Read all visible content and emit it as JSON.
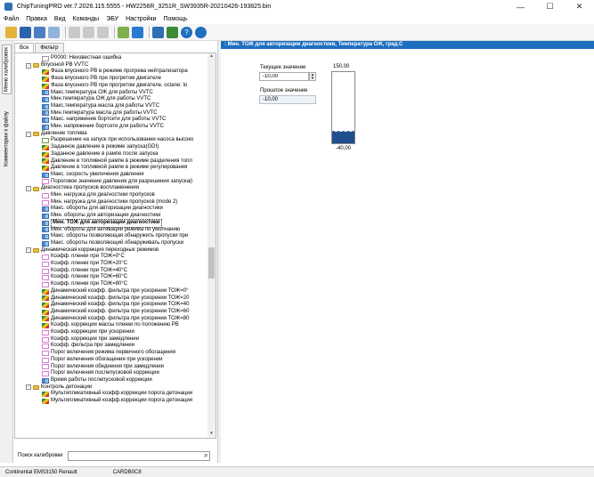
{
  "window": {
    "title": "ChipTuningPRO ver.7.2026.115.5555 - HW2256R_3251R_SW3935R-20210426-193825.bin",
    "minimize": "—",
    "maximize": "☐",
    "close": "✕"
  },
  "menu": [
    "Файл",
    "Правка",
    "Вид",
    "Команды",
    "ЭБУ",
    "Настройки",
    "Помощь"
  ],
  "side_tabs": {
    "maps": "Меню калибровок",
    "comments": "Комментарии к файлу"
  },
  "tree_tabs": [
    "Все",
    "Фильтр"
  ],
  "tree": [
    {
      "level": 2,
      "icon": "error-icon",
      "label": "P0000: Неизвестная ошибка"
    },
    {
      "level": 1,
      "icon": "folder-icon",
      "expand": "-",
      "label": "Впускной РВ VVTC"
    },
    {
      "level": 2,
      "icon": "map-3d-icon",
      "label": "Фаза впускного РВ в режиме прогрева нейтрализатора"
    },
    {
      "level": 2,
      "icon": "map-3d-icon",
      "label": "Фаза впускного РВ при прогретом двигателе"
    },
    {
      "level": 2,
      "icon": "map-3d-icon",
      "label": "Фаза впускного РВ при прогретом двигателе.  octane: lo"
    },
    {
      "level": 2,
      "icon": "map-2d-icon",
      "label": "Макс.температура ОЖ для работы VVTC"
    },
    {
      "level": 2,
      "icon": "map-2d-icon",
      "label": "Мин.температура ОЖ для работы VVTC"
    },
    {
      "level": 2,
      "icon": "map-2d-icon",
      "label": "Макс.температура масла для работы VVTC"
    },
    {
      "level": 2,
      "icon": "map-2d-icon",
      "label": "Мин.температура масла для работы VVTC"
    },
    {
      "level": 2,
      "icon": "map-2d-icon",
      "label": "Макс. напряжение бортсети для работы VVTC"
    },
    {
      "level": 2,
      "icon": "map-2d-icon",
      "label": "Мин. напряжение бортсети для работы VVTC"
    },
    {
      "level": 1,
      "icon": "folder-icon",
      "expand": "-",
      "label": "Давление топлива"
    },
    {
      "level": 2,
      "icon": "check-icon",
      "label": "Разрешение на запуск при использовании насоса высоко"
    },
    {
      "level": 2,
      "icon": "map-3d-icon",
      "label": "Заданное давление в режиме запуска(GDI)"
    },
    {
      "level": 2,
      "icon": "map-3d-icon",
      "label": "Заданное давление в рампе после запуска"
    },
    {
      "level": 2,
      "icon": "map-3d-icon",
      "label": "Давление в топливной рампе в режиме разделения топл"
    },
    {
      "level": 2,
      "icon": "map-3d-icon",
      "label": "Давление в топливной рампе в режиме регулирования"
    },
    {
      "level": 2,
      "icon": "map-2d-icon",
      "label": "Макс. скорость увеличения давления"
    },
    {
      "level": 2,
      "icon": "curve-icon",
      "label": "Пороговое значение давления для разрешения запуска(i"
    },
    {
      "level": 1,
      "icon": "folder-icon",
      "expand": "-",
      "label": "Диагностика пропусков воспламенения"
    },
    {
      "level": 2,
      "icon": "curve-icon",
      "label": "Мин. нагрузка для диагностики пропусков"
    },
    {
      "level": 2,
      "icon": "curve-icon",
      "label": "Мин. нагрузка для диагностики пропусков (mode 2)"
    },
    {
      "level": 2,
      "icon": "map-2d-icon",
      "label": "Макс. обороты для авторизации диагностики"
    },
    {
      "level": 2,
      "icon": "map-2d-icon",
      "label": "Мин. обороты для авторизации диагностики"
    },
    {
      "level": 2,
      "icon": "map-2d-icon",
      "label": "Мин. ТОЖ для авторизации диагностики",
      "selected": true
    },
    {
      "level": 2,
      "icon": "map-2d-icon",
      "label": "Мин. обороты для активации режима по умолчанию"
    },
    {
      "level": 2,
      "icon": "map-2d-icon",
      "label": "Макс. обороты  позволяющая обнаружить пропуски при"
    },
    {
      "level": 2,
      "icon": "map-2d-icon",
      "label": "Макс. обороты позволяющий обнаруживать пропуски"
    },
    {
      "level": 1,
      "icon": "folder-icon",
      "expand": "-",
      "label": "Динамическая коррекция переходных режимов"
    },
    {
      "level": 2,
      "icon": "curve-icon",
      "label": "Коэфф. пленки при ТОЖ=0°C"
    },
    {
      "level": 2,
      "icon": "curve-icon",
      "label": "Коэфф. пленки при ТОЖ=20°C"
    },
    {
      "level": 2,
      "icon": "curve-icon",
      "label": "Коэфф. пленки при ТОЖ=40°C"
    },
    {
      "level": 2,
      "icon": "curve-icon",
      "label": "Коэфф. пленки при ТОЖ=60°C"
    },
    {
      "level": 2,
      "icon": "curve-icon",
      "label": "Коэфф. пленки при ТОЖ=80°C"
    },
    {
      "level": 2,
      "icon": "map-3d-icon",
      "label": "Динамический коэфф. фильтра при ускорении ТОЖ=0°"
    },
    {
      "level": 2,
      "icon": "map-3d-icon",
      "label": "Динамический коэфф. фильтра при ускорении ТОЖ=20"
    },
    {
      "level": 2,
      "icon": "map-3d-icon",
      "label": "Динамический коэфф. фильтра при ускорении ТОЖ=40"
    },
    {
      "level": 2,
      "icon": "map-3d-icon",
      "label": "Динамический коэфф. фильтра при ускорении ТОЖ=60"
    },
    {
      "level": 2,
      "icon": "map-3d-icon",
      "label": "Динамический коэфф. фильтра при ускорении ТОЖ=80"
    },
    {
      "level": 2,
      "icon": "map-3d-icon",
      "label": "Коэфф. коррекции массы пленки по положению РВ"
    },
    {
      "level": 2,
      "icon": "curve-icon",
      "label": "Коэфф. коррекции при ускорении"
    },
    {
      "level": 2,
      "icon": "curve-icon",
      "label": "Коэфф. коррекции при замедлении"
    },
    {
      "level": 2,
      "icon": "curve-icon",
      "label": "Коэфф. фильтра при замедлении"
    },
    {
      "level": 2,
      "icon": "curve-icon",
      "label": "Порог включения режима первичного обогащения"
    },
    {
      "level": 2,
      "icon": "curve-icon",
      "label": "Порог включения обогащения при ускорении"
    },
    {
      "level": 2,
      "icon": "curve-icon",
      "label": "Порог включения обеднения при замедлении"
    },
    {
      "level": 2,
      "icon": "curve-icon",
      "label": "Порог включения послепусковой коррекции"
    },
    {
      "level": 2,
      "icon": "map-2d-icon",
      "label": "Время работы послепусковой коррекции"
    },
    {
      "level": 1,
      "icon": "folder-icon",
      "expand": "-",
      "label": "Контроль детонации"
    },
    {
      "level": 2,
      "icon": "map-3d-icon",
      "label": "Мультипликативный коэфф.коррекции порога детонации"
    },
    {
      "level": 2,
      "icon": "map-3d-icon",
      "label": "Мультипликативный коэфф.коррекции порога детонации"
    }
  ],
  "search": {
    "label": "Поиск калибровки",
    "value": "",
    "placeholder": ""
  },
  "panel": {
    "title": ": Мин. ТОЖ для авторизации диагностики, Температура ОЖ, град.С",
    "current_label": "Текущее значение",
    "current_value": "-10,00",
    "previous_label": "Прошлое значение",
    "previous_value": "-10,00",
    "gauge_max": "150,00",
    "gauge_min": "-40,00",
    "gauge_range": [
      -40,
      150
    ],
    "gauge_value": -10
  },
  "status": {
    "ecu": "Continental EMS3150 Renault",
    "checksum": "CARDB0C8"
  }
}
